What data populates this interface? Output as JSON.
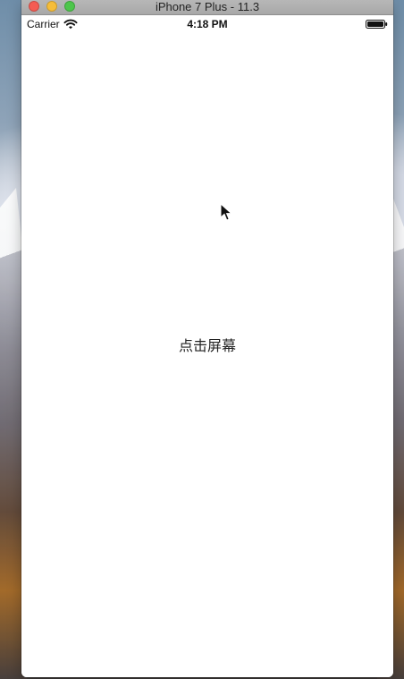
{
  "window": {
    "title": "iPhone 7 Plus - 11.3"
  },
  "status_bar": {
    "carrier": "Carrier",
    "time": "4:18 PM",
    "battery_level": 1
  },
  "content": {
    "message": "点击屏幕"
  },
  "icons": {
    "wifi": "wifi-icon",
    "battery": "battery-icon",
    "cursor": "mouse-cursor-icon"
  },
  "colors": {
    "window_title_bar": "#b0b0b0",
    "close": "#f45c53",
    "minimize": "#f6bd39",
    "maximize": "#4dc64b"
  }
}
